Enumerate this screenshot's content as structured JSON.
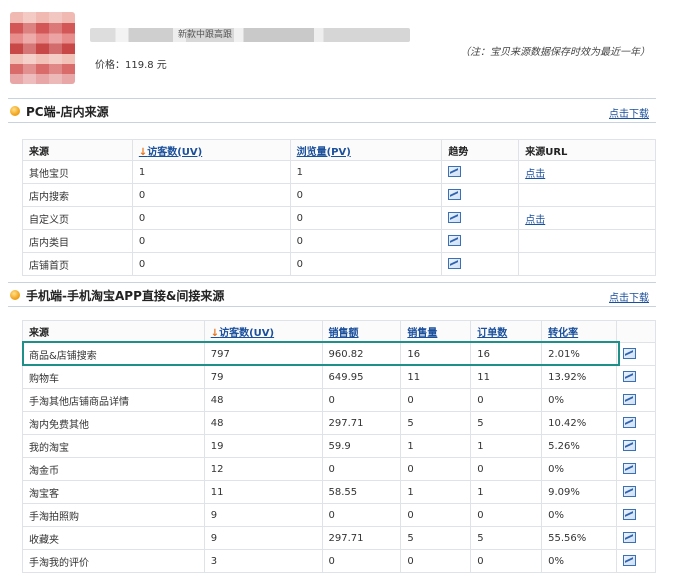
{
  "product": {
    "title_fragment": "新款中跟高跟",
    "price": "价格：119.8 元",
    "note": "（注：宝贝来源数据保存时效为最近一年）"
  },
  "pc_section": {
    "title": "PC端-店内来源",
    "download": "点击下载",
    "headers": [
      "来源",
      "访客数(UV)",
      "浏览量(PV)",
      "趋势",
      "来源URL"
    ],
    "rows": [
      {
        "source": "其他宝贝",
        "uv": "1",
        "pv": "1",
        "url": "点击"
      },
      {
        "source": "店内搜索",
        "uv": "0",
        "pv": "0",
        "url": ""
      },
      {
        "source": "自定义页",
        "uv": "0",
        "pv": "0",
        "url": "点击"
      },
      {
        "source": "店内类目",
        "uv": "0",
        "pv": "0",
        "url": ""
      },
      {
        "source": "店铺首页",
        "uv": "0",
        "pv": "0",
        "url": ""
      }
    ]
  },
  "mobile_section": {
    "title": "手机端-手机淘宝APP直接&间接来源",
    "download": "点击下载",
    "headers": [
      "来源",
      "访客数(UV)",
      "销售额",
      "销售量",
      "订单数",
      "转化率"
    ],
    "rows": [
      {
        "source": "商品&店铺搜索",
        "uv": "797",
        "sales": "960.82",
        "qty": "16",
        "orders": "16",
        "conv": "2.01%"
      },
      {
        "source": "购物车",
        "uv": "79",
        "sales": "649.95",
        "qty": "11",
        "orders": "11",
        "conv": "13.92%"
      },
      {
        "source": "手淘其他店铺商品详情",
        "uv": "48",
        "sales": "0",
        "qty": "0",
        "orders": "0",
        "conv": "0%"
      },
      {
        "source": "淘内免费其他",
        "uv": "48",
        "sales": "297.71",
        "qty": "5",
        "orders": "5",
        "conv": "10.42%"
      },
      {
        "source": "我的淘宝",
        "uv": "19",
        "sales": "59.9",
        "qty": "1",
        "orders": "1",
        "conv": "5.26%"
      },
      {
        "source": "淘金币",
        "uv": "12",
        "sales": "0",
        "qty": "0",
        "orders": "0",
        "conv": "0%"
      },
      {
        "source": "淘宝客",
        "uv": "11",
        "sales": "58.55",
        "qty": "1",
        "orders": "1",
        "conv": "9.09%"
      },
      {
        "source": "手淘拍照购",
        "uv": "9",
        "sales": "0",
        "qty": "0",
        "orders": "0",
        "conv": "0%"
      },
      {
        "source": "收藏夹",
        "uv": "9",
        "sales": "297.71",
        "qty": "5",
        "orders": "5",
        "conv": "55.56%"
      },
      {
        "source": "手淘我的评价",
        "uv": "3",
        "sales": "0",
        "qty": "0",
        "orders": "0",
        "conv": "0%"
      }
    ]
  },
  "icons": {
    "trend": "trend-chart-icon",
    "section": "orange-dot-icon",
    "sort": "down-arrow-icon"
  },
  "colors": {
    "link": "#1a4f9b",
    "highlight": "#1f8f8a",
    "sort_arrow": "#e8731a"
  }
}
